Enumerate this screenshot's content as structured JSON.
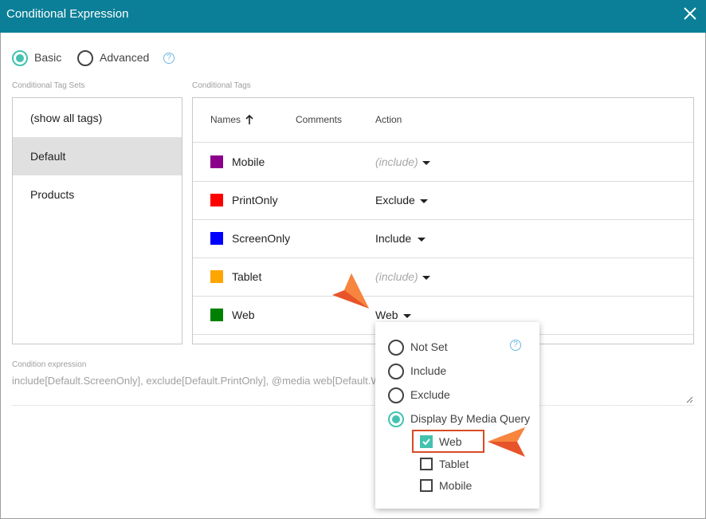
{
  "dialog": {
    "title": "Conditional Expression"
  },
  "mode": {
    "basic_label": "Basic",
    "advanced_label": "Advanced",
    "selected": "Basic"
  },
  "tag_sets": {
    "label": "Conditional Tag Sets",
    "items": [
      {
        "label": "(show all tags)",
        "selected": false
      },
      {
        "label": "Default",
        "selected": true
      },
      {
        "label": "Products",
        "selected": false
      }
    ]
  },
  "tags": {
    "label": "Conditional Tags",
    "columns": {
      "names": "Names",
      "comments": "Comments",
      "action": "Action"
    },
    "rows": [
      {
        "name": "Mobile",
        "color": "#8b008b",
        "action": "(include)",
        "muted": true
      },
      {
        "name": "PrintOnly",
        "color": "#ff0000",
        "action": "Exclude",
        "muted": false
      },
      {
        "name": "ScreenOnly",
        "color": "#0000ff",
        "action": "Include",
        "muted": false
      },
      {
        "name": "Tablet",
        "color": "#ffa500",
        "action": "(include)",
        "muted": true
      },
      {
        "name": "Web",
        "color": "#008000",
        "action": "Web",
        "muted": false
      }
    ]
  },
  "expression": {
    "label": "Condition expression",
    "value": "include[Default.ScreenOnly], exclude[Default.PrintOnly], @media web[Default.Web]"
  },
  "action_menu": {
    "options": [
      {
        "label": "Not Set",
        "selected": false
      },
      {
        "label": "Include",
        "selected": false
      },
      {
        "label": "Exclude",
        "selected": false
      },
      {
        "label": "Display By Media Query",
        "selected": true
      }
    ],
    "media": [
      {
        "label": "Web",
        "checked": true
      },
      {
        "label": "Tablet",
        "checked": false
      },
      {
        "label": "Mobile",
        "checked": false
      }
    ]
  },
  "colors": {
    "title_bar": "#0b7f97",
    "accent": "#44c2b0",
    "callout": "#e8542a"
  }
}
